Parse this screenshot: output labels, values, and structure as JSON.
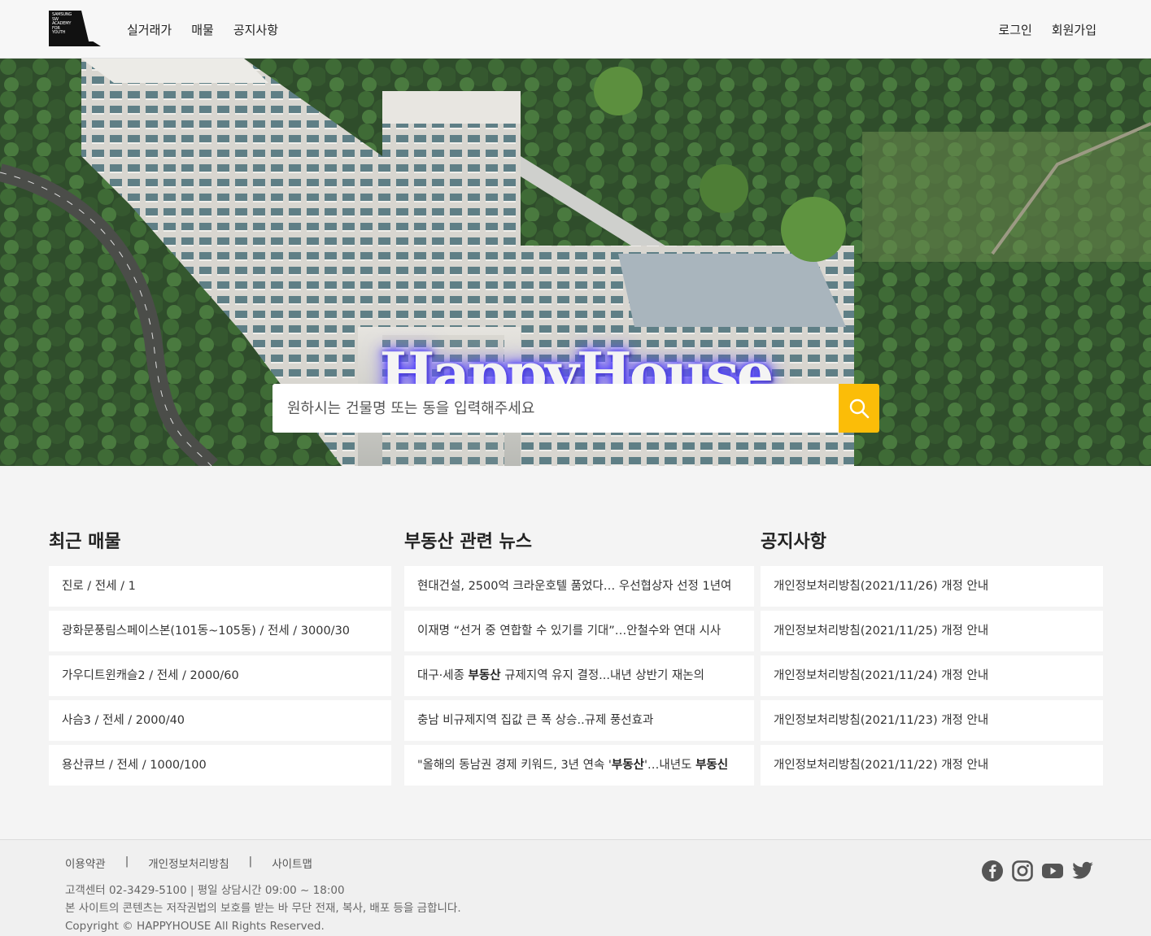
{
  "logo": {
    "text_lines": [
      "SAMSUNG",
      "SW",
      "ACADEMY",
      "FOR",
      "YOUTH"
    ]
  },
  "nav": {
    "items": [
      "실거래가",
      "매물",
      "공지사항"
    ]
  },
  "auth": {
    "login": "로그인",
    "signup": "회원가입"
  },
  "hero": {
    "title": "HappyHouse",
    "search_placeholder": "원하시는 건물명 또는 동을 입력해주세요",
    "search_icon": "search-icon",
    "accent_color": "#fbbd08"
  },
  "sections": {
    "recent": {
      "title": "최근 매물",
      "items": [
        "진로 / 전세 / 1",
        "광화문풍림스페이스본(101동~105동) / 전세 / 3000/30",
        "가우디트윈캐슬2 / 전세 / 2000/60",
        "사슴3 / 전세 / 2000/40",
        "용산큐브 / 전세 / 1000/100"
      ]
    },
    "news": {
      "title": "부동산 관련 뉴스",
      "items": [
        {
          "pre": "현대건설, 2500억 크라운호텔 품었다… 우선협상자 선정 1년여",
          "bold": "",
          "post": "",
          "bold2": ""
        },
        {
          "pre": "이재명 “선거 중 연합할 수 있기를 기대”…안철수와 연대 시사",
          "bold": "",
          "post": "",
          "bold2": ""
        },
        {
          "pre": "대구·세종 ",
          "bold": "부동산",
          "post": " 규제지역 유지 결정...내년 상반기 재논의",
          "bold2": ""
        },
        {
          "pre": "충남 비규제지역 집값 큰 폭 상승..규제 풍선효과",
          "bold": "",
          "post": "",
          "bold2": ""
        },
        {
          "pre": "\"올해의 동남권 경제 키워드, 3년 연속 '",
          "bold": "부동산",
          "post": "'…내년도 ",
          "bold2": "부동신"
        }
      ]
    },
    "notice": {
      "title": "공지사항",
      "items": [
        "개인정보처리방침(2021/11/26) 개정 안내",
        "개인정보처리방침(2021/11/25) 개정 안내",
        "개인정보처리방침(2021/11/24) 개정 안내",
        "개인정보처리방침(2021/11/23) 개정 안내",
        "개인정보처리방침(2021/11/22) 개정 안내"
      ]
    }
  },
  "footer": {
    "links": [
      "이용약관",
      "개인정보처리방침",
      "사이트맵"
    ],
    "separator": "|",
    "info": [
      "고객센터 02-3429-5100 | 평일 상담시간 09:00 ~ 18:00",
      "본 사이트의 콘텐츠는 저작권법의 보호를 받는 바 무단 전재, 복사, 배포 등을 금합니다.",
      "Copyright © HAPPYHOUSE All Rights Reserved."
    ],
    "social_icons": [
      "facebook-icon",
      "instagram-icon",
      "youtube-icon",
      "twitter-icon"
    ]
  }
}
